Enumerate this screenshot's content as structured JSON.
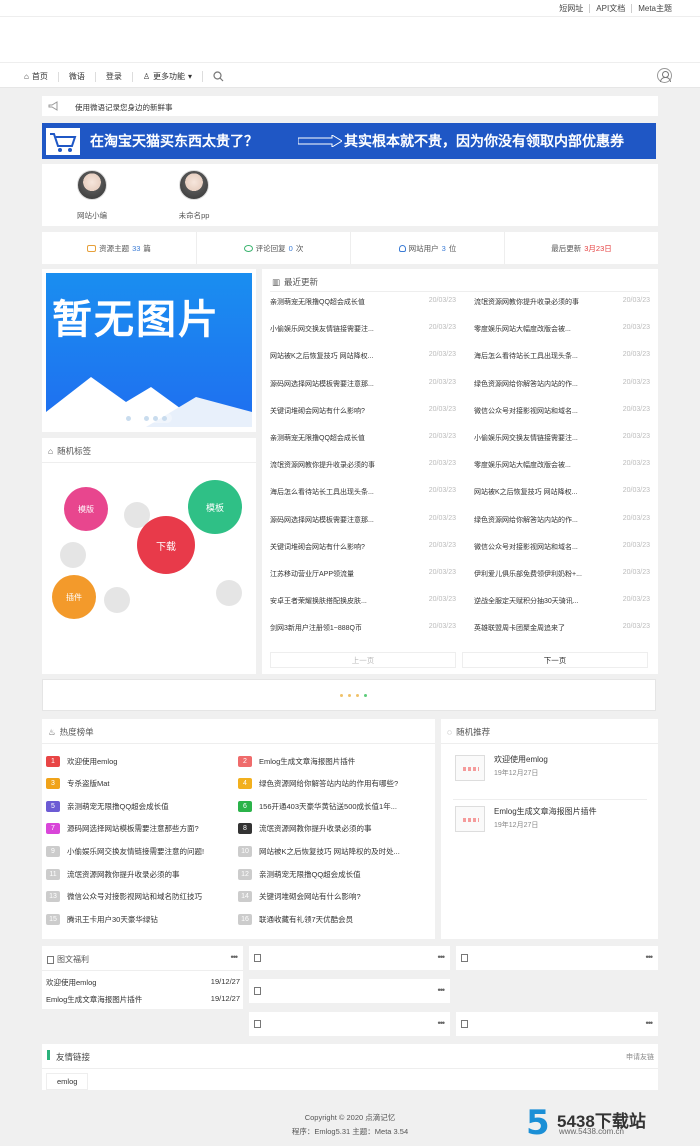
{
  "top_links": [
    "短网址",
    "API文档",
    "Meta主题"
  ],
  "nav": {
    "items": [
      "首页",
      "微语",
      "登录",
      "更多功能"
    ]
  },
  "notice": "使用微语记录您身边的新鲜事",
  "banner": {
    "left": "在淘宝天猫买东西太贵了？",
    "right": "其实根本就不贵，因为你没有领取内部优惠券"
  },
  "authors": [
    "网站小编",
    "未命名pp"
  ],
  "stats": {
    "posts": {
      "label": "资源主题",
      "value": "33",
      "unit": "篇"
    },
    "comments": {
      "label": "评论回复",
      "value": "0",
      "unit": "次"
    },
    "users": {
      "label": "网站用户",
      "value": "3",
      "unit": "位"
    },
    "updated": {
      "label": "最后更新",
      "value": "3月23日"
    }
  },
  "slider": {
    "text": "暂无图片"
  },
  "tags": {
    "title": "随机标签",
    "items": [
      "模版",
      "模板",
      "下载",
      "插件"
    ]
  },
  "latest": {
    "title": "最近更新",
    "left": [
      {
        "t": "亲测萌宠无限撸QQ超会成长值",
        "d": "20/03/23"
      },
      {
        "t": "小偷娱乐网交换友情链接需要注...",
        "d": "20/03/23"
      },
      {
        "t": "网站被K之后恢复技巧 网站降权...",
        "d": "20/03/23"
      },
      {
        "t": "源码网选择网站模板需要注意那...",
        "d": "20/03/23"
      },
      {
        "t": "关键词堆砌会网站有什么影响?",
        "d": "20/03/23"
      },
      {
        "t": "亲测萌宠无限撸QQ超会成长值",
        "d": "20/03/23"
      },
      {
        "t": "流氓资源网教你提升收录必须的事",
        "d": "20/03/23"
      },
      {
        "t": "海后怎么看待站长工具出现头条...",
        "d": "20/03/23"
      },
      {
        "t": "源码网选择网站模板需要注意那...",
        "d": "20/03/23"
      },
      {
        "t": "关键词堆砌会网站有什么影响?",
        "d": "20/03/23"
      },
      {
        "t": "江苏移动营业厅APP领流量",
        "d": "20/03/23"
      },
      {
        "t": "安卓王者荣耀换肤搭配换皮肤...",
        "d": "20/03/23"
      },
      {
        "t": "剑网3新用户注册领1~888Q币",
        "d": "20/03/23"
      }
    ],
    "right": [
      {
        "t": "流氓资源网教你提升收录必须的事",
        "d": "20/03/23"
      },
      {
        "t": "零度娱乐网站大幅度改版会被...",
        "d": "20/03/23"
      },
      {
        "t": "海后怎么看待站长工具出现头条...",
        "d": "20/03/23"
      },
      {
        "t": "绿色资源网给你解答站内站的作...",
        "d": "20/03/23"
      },
      {
        "t": "微信公众号对接影视网站和域名...",
        "d": "20/03/23"
      },
      {
        "t": "小偷娱乐网交换友情链接需要注...",
        "d": "20/03/23"
      },
      {
        "t": "零度娱乐网站大幅度改版会被...",
        "d": "20/03/23"
      },
      {
        "t": "网站被K之后恢复技巧 网站降权...",
        "d": "20/03/23"
      },
      {
        "t": "绿色资源网给你解答站内站的作...",
        "d": "20/03/23"
      },
      {
        "t": "微信公众号对接影视网站和域名...",
        "d": "20/03/23"
      },
      {
        "t": "伊利爱儿俱乐部免费领伊利奶粉+...",
        "d": "20/03/23"
      },
      {
        "t": "逆战全服定天赋积分抽30天骑讯...",
        "d": "20/03/23"
      },
      {
        "t": "英雄联盟周卡团聚金周追来了",
        "d": "20/03/23"
      }
    ],
    "prev": "上一页",
    "next": "下一页"
  },
  "hot": {
    "title": "热度榜单",
    "left": [
      {
        "n": "1",
        "t": "欢迎使用emlog",
        "c": "#e84545"
      },
      {
        "n": "3",
        "t": "专杀盗版Mat",
        "c": "#f0a31a"
      },
      {
        "n": "5",
        "t": "亲测萌宠无限撸QQ超会成长值",
        "c": "#6c5bd4"
      },
      {
        "n": "7",
        "t": "源码网选择网站模板需要注意那些方面?",
        "c": "#d946d9"
      },
      {
        "n": "9",
        "t": "小偷娱乐网交换友情链接需要注意的问题!",
        "c": "#cccccc"
      },
      {
        "n": "11",
        "t": "流氓资源网教你提升收录必须的事",
        "c": "#cccccc"
      },
      {
        "n": "13",
        "t": "微信公众号对接影视网站和域名防红技巧",
        "c": "#cccccc"
      },
      {
        "n": "15",
        "t": "腾讯王卡用户30天豪华绿钻",
        "c": "#cccccc"
      }
    ],
    "right": [
      {
        "n": "2",
        "t": "Emlog生成文章海报图片插件",
        "c": "#ef6b6b"
      },
      {
        "n": "4",
        "t": "绿色资源网给你解答站内站的作用有哪些?",
        "c": "#f2b01e"
      },
      {
        "n": "6",
        "t": "156开通403天豪华黄钻送500成长值1年...",
        "c": "#2bb34a"
      },
      {
        "n": "8",
        "t": "流氓资源网教你提升收录必须的事",
        "c": "#333333"
      },
      {
        "n": "10",
        "t": "网站被K之后恢复技巧 网站降权的及时处...",
        "c": "#cccccc"
      },
      {
        "n": "12",
        "t": "亲测萌宠无限撸QQ超会成长值",
        "c": "#cccccc"
      },
      {
        "n": "14",
        "t": "关键词堆砌会网站有什么影响?",
        "c": "#cccccc"
      },
      {
        "n": "16",
        "t": "联通收藏有礼领7天优酷会员",
        "c": "#cccccc"
      }
    ]
  },
  "recommend": {
    "title": "随机推荐",
    "items": [
      {
        "t": "欢迎使用emlog",
        "d": "19年12月27日"
      },
      {
        "t": "Emlog生成文章海报图片插件",
        "d": "19年12月27日"
      }
    ]
  },
  "tuwen": {
    "title": "图文福利",
    "items": [
      {
        "t": "欢迎使用emlog",
        "d": "19/12/27"
      },
      {
        "t": "Emlog生成文章海报图片插件",
        "d": "19/12/27"
      }
    ]
  },
  "more_icon": "•••",
  "friends": {
    "title": "友情链接",
    "apply": "申请友链",
    "links": [
      "emlog"
    ]
  },
  "footer": {
    "line1": "Copyright © 2020  点滴记忆",
    "line2": "程序：Emlog5.31      主题：Meta 3.54"
  },
  "watermark": {
    "num": "5",
    "name": "5438下载站",
    "url": "www.5438.com.cn"
  }
}
